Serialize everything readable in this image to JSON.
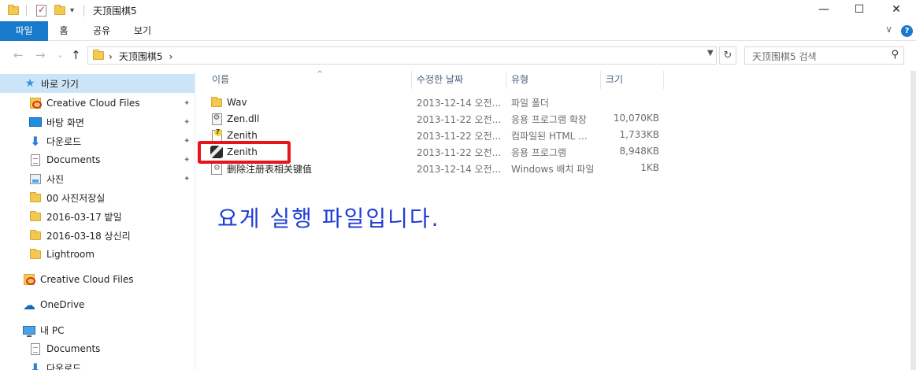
{
  "window": {
    "title": "天顶围棋5",
    "minimize": "—",
    "maximize": "☐",
    "close": "✕"
  },
  "ribbon": {
    "tabs": [
      "파일",
      "홈",
      "공유",
      "보기"
    ],
    "expand": "∨",
    "help": "?"
  },
  "nav": {
    "back": "←",
    "forward": "→",
    "recent": "⌄",
    "up": "↑",
    "breadcrumb_sep1": "›",
    "breadcrumb_current": "天顶围棋5",
    "breadcrumb_sep2": "›",
    "refresh": "↻",
    "search_placeholder": "天顶围棋5 검색",
    "search_icon": "⚲"
  },
  "sidebar": {
    "items": [
      {
        "label": "바로 가기",
        "icon": "star-icon",
        "selected": true
      },
      {
        "label": "Creative Cloud Files",
        "icon": "creative-cloud-icon",
        "pinned": true
      },
      {
        "label": "바탕 화면",
        "icon": "desktop-icon",
        "pinned": true
      },
      {
        "label": "다운로드",
        "icon": "download-icon",
        "pinned": true
      },
      {
        "label": "Documents",
        "icon": "document-icon",
        "pinned": true
      },
      {
        "label": "사진",
        "icon": "picture-icon",
        "pinned": true
      },
      {
        "label": "00 사진저장실",
        "icon": "folder-icon"
      },
      {
        "label": "2016-03-17 밭일",
        "icon": "folder-icon"
      },
      {
        "label": "2016-03-18 상신리",
        "icon": "folder-icon"
      },
      {
        "label": "Lightroom",
        "icon": "folder-icon"
      },
      {
        "label": "Creative Cloud Files",
        "icon": "creative-cloud-icon"
      },
      {
        "label": "OneDrive",
        "icon": "onedrive-icon"
      },
      {
        "label": "내 PC",
        "icon": "pc-icon"
      },
      {
        "label": "Documents",
        "icon": "document-icon"
      },
      {
        "label": "다운로드",
        "icon": "download-icon"
      }
    ],
    "pin_glyph": "📌"
  },
  "columns": {
    "name": "이름",
    "date": "수정한 날짜",
    "type": "유형",
    "size": "크기",
    "sort_indicator": "^"
  },
  "files": [
    {
      "name": "Wav",
      "date": "2013-12-14 오전...",
      "type": "파일 폴더",
      "size": "",
      "icon": "folder-icon"
    },
    {
      "name": "Zen.dll",
      "date": "2013-11-22 오전...",
      "type": "응용 프로그램 확장",
      "size": "10,070KB",
      "icon": "dll-icon"
    },
    {
      "name": "Zenith",
      "date": "2013-11-22 오전...",
      "type": "컴파일된 HTML ...",
      "size": "1,733KB",
      "icon": "chm-help-icon"
    },
    {
      "name": "Zenith",
      "date": "2013-11-22 오전...",
      "type": "응용 프로그램",
      "size": "8,948KB",
      "icon": "zenith-app-icon"
    },
    {
      "name": "删除注册表相关键值",
      "date": "2013-12-14 오전...",
      "type": "Windows 배치 파일",
      "size": "1KB",
      "icon": "batch-file-icon"
    }
  ],
  "annotation": "요게 실행 파일입니다.",
  "colors": {
    "accent": "#1979ca",
    "selection": "#cce4f7",
    "highlight_box": "#e8141d",
    "annotation_text": "#1e3bd6"
  }
}
